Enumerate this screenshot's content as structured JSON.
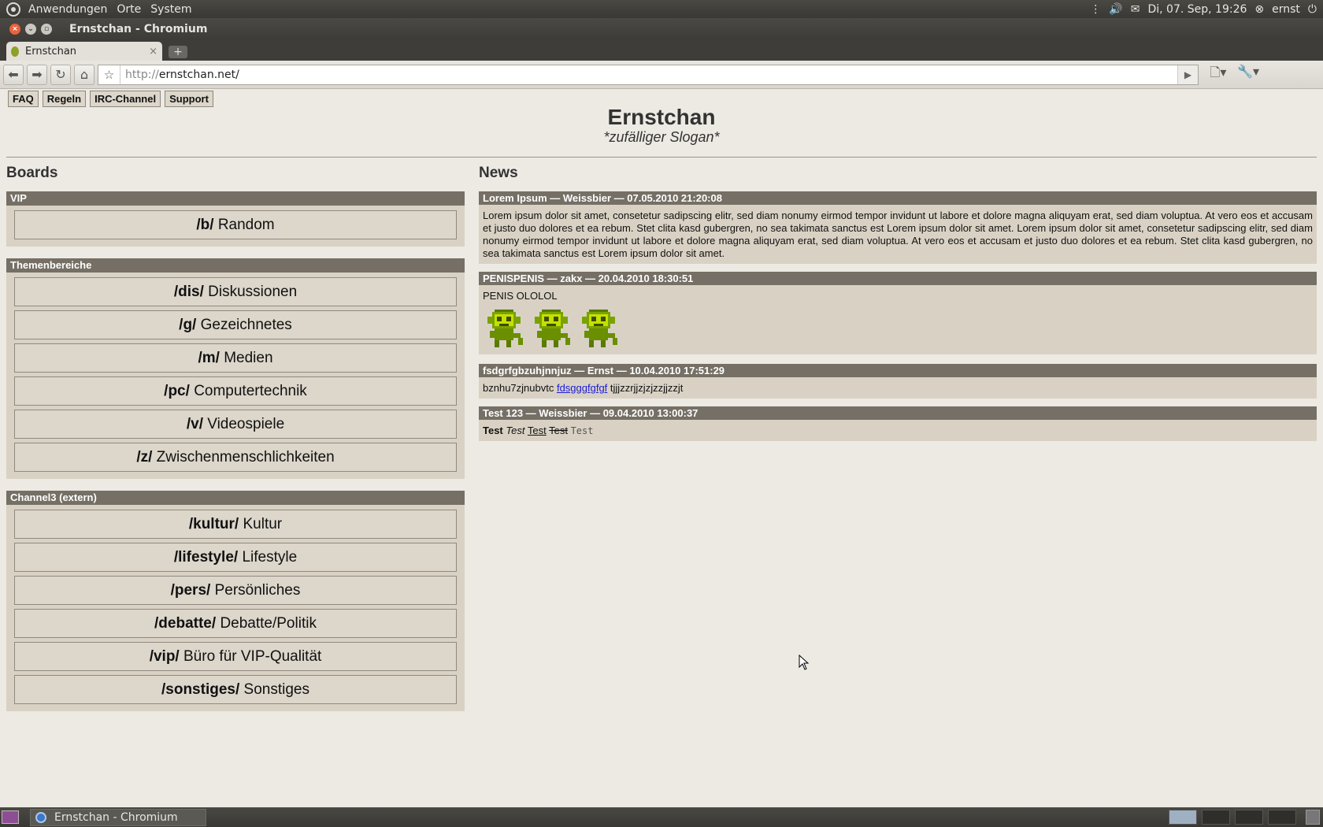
{
  "top_panel": {
    "menus": [
      "Anwendungen",
      "Orte",
      "System"
    ],
    "clock": "Di, 07. Sep, 19:26",
    "user": "ernst"
  },
  "window": {
    "title": "Ernstchan - Chromium"
  },
  "browser": {
    "tab_title": "Ernstchan",
    "url_scheme": "http://",
    "url_host": "ernstchan.net/"
  },
  "site": {
    "nav_links": [
      "FAQ",
      "Regeln",
      "IRC-Channel",
      "Support"
    ],
    "title": "Ernstchan",
    "slogan": "*zufälliger Slogan*",
    "boards_heading": "Boards",
    "news_heading": "News"
  },
  "board_groups": [
    {
      "name": "VIP",
      "boards": [
        {
          "code": "/b/",
          "name": "Random"
        }
      ]
    },
    {
      "name": "Themenbereiche",
      "boards": [
        {
          "code": "/dis/",
          "name": "Diskussionen"
        },
        {
          "code": "/g/",
          "name": "Gezeichnetes"
        },
        {
          "code": "/m/",
          "name": "Medien"
        },
        {
          "code": "/pc/",
          "name": "Computertechnik"
        },
        {
          "code": "/v/",
          "name": "Videospiele"
        },
        {
          "code": "/z/",
          "name": "Zwischenmenschlichkeiten"
        }
      ]
    },
    {
      "name": "Channel3 (extern)",
      "boards": [
        {
          "code": "/kultur/",
          "name": "Kultur"
        },
        {
          "code": "/lifestyle/",
          "name": "Lifestyle"
        },
        {
          "code": "/pers/",
          "name": "Persönliches"
        },
        {
          "code": "/debatte/",
          "name": "Debatte/Politik"
        },
        {
          "code": "/vip/",
          "name": "Büro für VIP-Qualität"
        },
        {
          "code": "/sonstiges/",
          "name": "Sonstiges"
        }
      ]
    }
  ],
  "news": [
    {
      "header": "Lorem Ipsum — Weissbier — 07.05.2010 21:20:08",
      "text": "Lorem ipsum dolor sit amet, consetetur sadipscing elitr, sed diam nonumy eirmod tempor invidunt ut labore et dolore magna aliquyam erat, sed diam voluptua. At vero eos et accusam et justo duo dolores et ea rebum. Stet clita kasd gubergren, no sea takimata sanctus est Lorem ipsum dolor sit amet. Lorem ipsum dolor sit amet, consetetur sadipscing elitr, sed diam nonumy eirmod tempor invidunt ut labore et dolore magna aliquyam erat, sed diam voluptua. At vero eos et accusam et justo duo dolores et ea rebum. Stet clita kasd gubergren, no sea takimata sanctus est Lorem ipsum dolor sit amet."
    },
    {
      "header": "PENISPENIS — zakx — 20.04.2010 18:30:51",
      "text": "PENIS OLOLOL",
      "image_count": 3
    },
    {
      "header": "fsdgrfgbzuhjnnjuz — Ernst — 10.04.2010 17:51:29",
      "text_before": "bznhu7zjnubvtc",
      "link": "fdsgggfgfgf",
      "text_after": "tjjjzzrjjzjzjzzjjzzjt"
    },
    {
      "header": "Test 123 — Weissbier — 09.04.2010 13:00:37",
      "formats": [
        "Test",
        "Test",
        "Test",
        "Test",
        "Test"
      ]
    }
  ],
  "taskbar": {
    "task_label": "Ernstchan - Chromium"
  },
  "colors": {
    "header_bg": "#756f65",
    "box_bg": "#d9d2c4",
    "page_bg": "#edeae4",
    "link": "#1a1ad9"
  }
}
